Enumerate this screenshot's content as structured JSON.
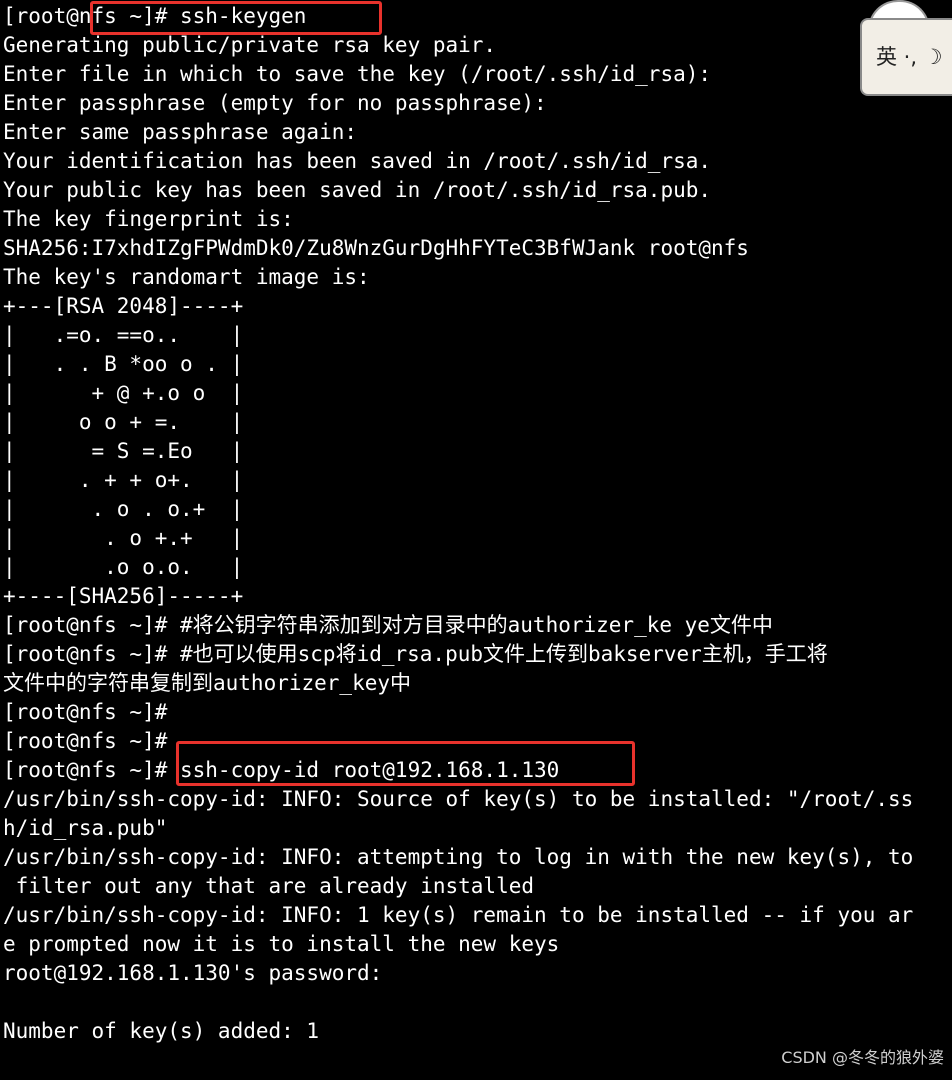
{
  "terminal": {
    "lines": [
      "[root@nfs ~]# ssh-keygen",
      "Generating public/private rsa key pair.",
      "Enter file in which to save the key (/root/.ssh/id_rsa):",
      "Enter passphrase (empty for no passphrase):",
      "Enter same passphrase again:",
      "Your identification has been saved in /root/.ssh/id_rsa.",
      "Your public key has been saved in /root/.ssh/id_rsa.pub.",
      "The key fingerprint is:",
      "SHA256:I7xhdIZgFPWdmDk0/Zu8WnzGurDgHhFYTeC3BfWJank root@nfs",
      "The key's randomart image is:",
      "+---[RSA 2048]----+",
      "|   .=o. ==o..    |",
      "|   . . B *oo o . |",
      "|      + @ +.o o  |",
      "|     o o + =.    |",
      "|      = S =.Eo   |",
      "|     . + + o+.   |",
      "|      . o . o.+  |",
      "|       . o +.+   |",
      "|       .o o.o.   |",
      "+----[SHA256]-----+",
      "[root@nfs ~]# #将公钥字符串添加到对方目录中的authorizer_ke ye文件中",
      "[root@nfs ~]# #也可以使用scp将id_rsa.pub文件上传到bakserver主机，手工将",
      "文件中的字符串复制到authorizer_key中",
      "[root@nfs ~]#",
      "[root@nfs ~]#",
      "[root@nfs ~]# ssh-copy-id root@192.168.1.130",
      "/usr/bin/ssh-copy-id: INFO: Source of key(s) to be installed: \"/root/.ss",
      "h/id_rsa.pub\"",
      "/usr/bin/ssh-copy-id: INFO: attempting to log in with the new key(s), to",
      " filter out any that are already installed",
      "/usr/bin/ssh-copy-id: INFO: 1 key(s) remain to be installed -- if you ar",
      "e prompted now it is to install the new keys",
      "root@192.168.1.130's password:",
      "",
      "Number of key(s) added: 1"
    ]
  },
  "ime": {
    "label": "英 ·, ☽"
  },
  "watermark": "CSDN @冬冬的狼外婆",
  "colors": {
    "background": "#000000",
    "text": "#ffffff",
    "highlight": "#e8322c"
  }
}
